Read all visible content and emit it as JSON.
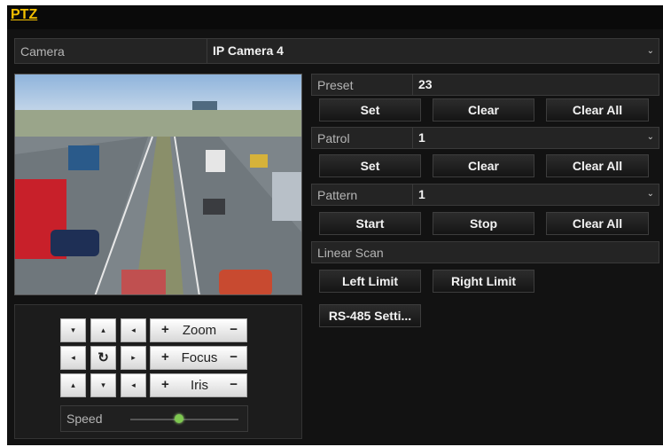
{
  "window": {
    "title": "PTZ"
  },
  "camera": {
    "label": "Camera",
    "value": "IP Camera 4"
  },
  "preset": {
    "label": "Preset",
    "value": "23",
    "set": "Set",
    "clear": "Clear",
    "clear_all": "Clear All"
  },
  "patrol": {
    "label": "Patrol",
    "value": "1",
    "set": "Set",
    "clear": "Clear",
    "clear_all": "Clear All"
  },
  "pattern": {
    "label": "Pattern",
    "value": "1",
    "start": "Start",
    "stop": "Stop",
    "clear_all": "Clear All"
  },
  "linear_scan": {
    "label": "Linear Scan",
    "left_limit": "Left Limit",
    "right_limit": "Right Limit"
  },
  "rs485": {
    "label": "RS-485 Setti..."
  },
  "ptz_controls": {
    "zoom": "Zoom",
    "focus": "Focus",
    "iris": "Iris",
    "plus": "+",
    "minus": "−",
    "speed_label": "Speed",
    "speed_level": 0.45
  },
  "icons": {
    "dropdown": "chevron-down-icon",
    "directions": [
      "arrow-up-left-icon",
      "arrow-up-icon",
      "arrow-up-right-icon",
      "arrow-left-icon",
      "auto-rotate-icon",
      "arrow-right-icon",
      "arrow-down-left-icon",
      "arrow-down-icon",
      "arrow-down-right-icon"
    ]
  },
  "colors": {
    "accent": "#f5c000",
    "background": "#121212",
    "panel": "#242424"
  }
}
